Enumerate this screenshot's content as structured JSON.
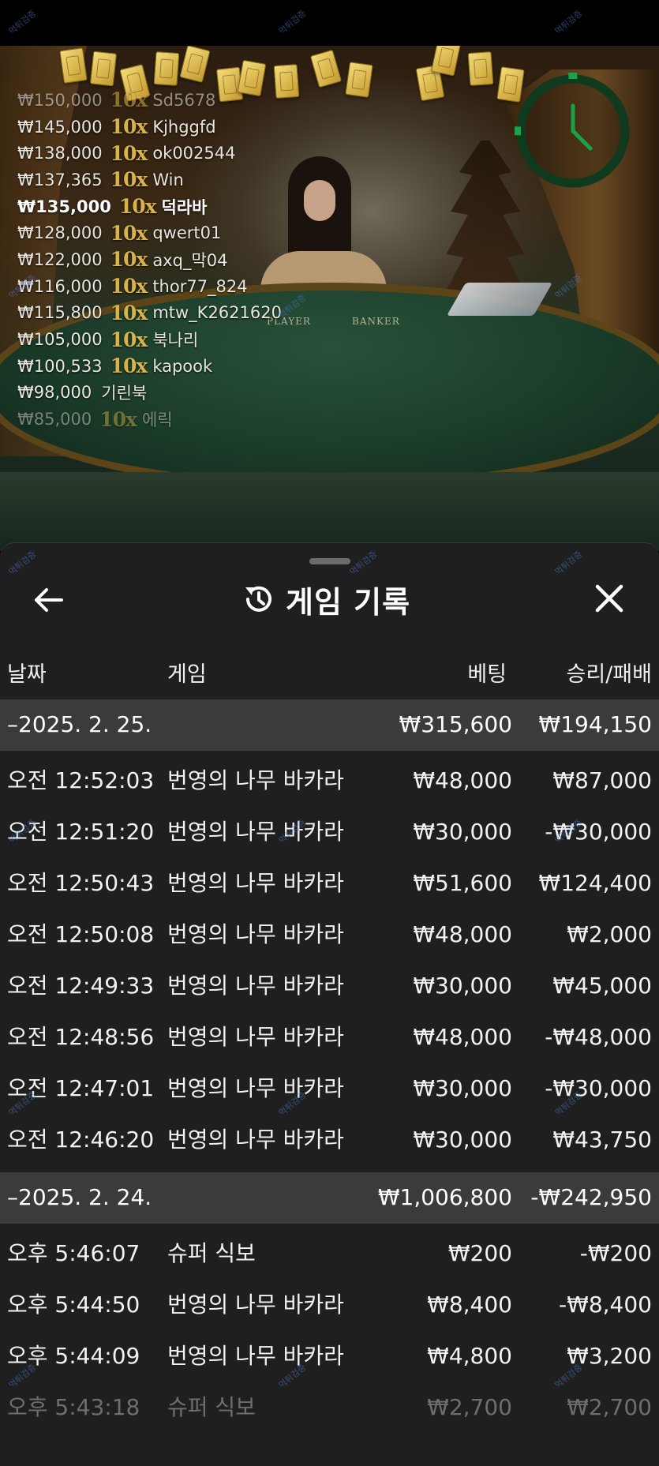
{
  "stream": {
    "felt_labels": [
      "PLAYER",
      "BANKER"
    ],
    "timer_color": "#19a347",
    "winners": [
      {
        "amount": "₩150,000",
        "mult": "10x",
        "name": "Sd5678",
        "bold": false
      },
      {
        "amount": "₩145,000",
        "mult": "10x",
        "name": "Kjhggfd",
        "bold": false
      },
      {
        "amount": "₩138,000",
        "mult": "10x",
        "name": "ok002544",
        "bold": false
      },
      {
        "amount": "₩137,365",
        "mult": "10x",
        "name": "Win",
        "bold": false
      },
      {
        "amount": "₩135,000",
        "mult": "10x",
        "name": "덕라바",
        "bold": true
      },
      {
        "amount": "₩128,000",
        "mult": "10x",
        "name": "qwert01",
        "bold": false
      },
      {
        "amount": "₩122,000",
        "mult": "10x",
        "name": "axq_막04",
        "bold": false
      },
      {
        "amount": "₩116,000",
        "mult": "10x",
        "name": "thor77_824",
        "bold": false
      },
      {
        "amount": "₩115,800",
        "mult": "10x",
        "name": "mtw_K2621620",
        "bold": false
      },
      {
        "amount": "₩105,000",
        "mult": "10x",
        "name": "북나리",
        "bold": false
      },
      {
        "amount": "₩100,533",
        "mult": "10x",
        "name": "kapook",
        "bold": false
      },
      {
        "amount": "₩98,000",
        "mult": "",
        "name": "기린북",
        "bold": false
      },
      {
        "amount": "₩85,000",
        "mult": "10x",
        "name": "에릭",
        "bold": false
      }
    ]
  },
  "panel": {
    "title": "게임 기록",
    "columns": {
      "date": "날짜",
      "game": "게임",
      "bet": "베팅",
      "winloss": "승리/패배"
    },
    "sections": [
      {
        "date": "–2025. 2. 25.",
        "bet_total": "₩315,600",
        "win_total": "₩194,150",
        "rows": [
          {
            "time": "오전 12:52:03",
            "game": "번영의 나무 바카라",
            "bet": "₩48,000",
            "win": "₩87,000"
          },
          {
            "time": "오전 12:51:20",
            "game": "번영의 나무 바카라",
            "bet": "₩30,000",
            "win": "-₩30,000"
          },
          {
            "time": "오전 12:50:43",
            "game": "번영의 나무 바카라",
            "bet": "₩51,600",
            "win": "₩124,400"
          },
          {
            "time": "오전 12:50:08",
            "game": "번영의 나무 바카라",
            "bet": "₩48,000",
            "win": "₩2,000"
          },
          {
            "time": "오전 12:49:33",
            "game": "번영의 나무 바카라",
            "bet": "₩30,000",
            "win": "₩45,000"
          },
          {
            "time": "오전 12:48:56",
            "game": "번영의 나무 바카라",
            "bet": "₩48,000",
            "win": "-₩48,000"
          },
          {
            "time": "오전 12:47:01",
            "game": "번영의 나무 바카라",
            "bet": "₩30,000",
            "win": "-₩30,000"
          },
          {
            "time": "오전 12:46:20",
            "game": "번영의 나무 바카라",
            "bet": "₩30,000",
            "win": "₩43,750"
          }
        ]
      },
      {
        "date": "–2025. 2. 24.",
        "bet_total": "₩1,006,800",
        "win_total": "-₩242,950",
        "rows": [
          {
            "time": "오후 5:46:07",
            "game": "슈퍼 식보",
            "bet": "₩200",
            "win": "-₩200"
          },
          {
            "time": "오후 5:44:50",
            "game": "번영의 나무 바카라",
            "bet": "₩8,400",
            "win": "-₩8,400"
          },
          {
            "time": "오후 5:44:09",
            "game": "번영의 나무 바카라",
            "bet": "₩4,800",
            "win": "₩3,200"
          },
          {
            "time": "오후 5:43:18",
            "game": "슈퍼 식보",
            "bet": "₩2,700",
            "win": "₩2,700"
          }
        ]
      }
    ]
  },
  "watermark": "먹튀검증"
}
